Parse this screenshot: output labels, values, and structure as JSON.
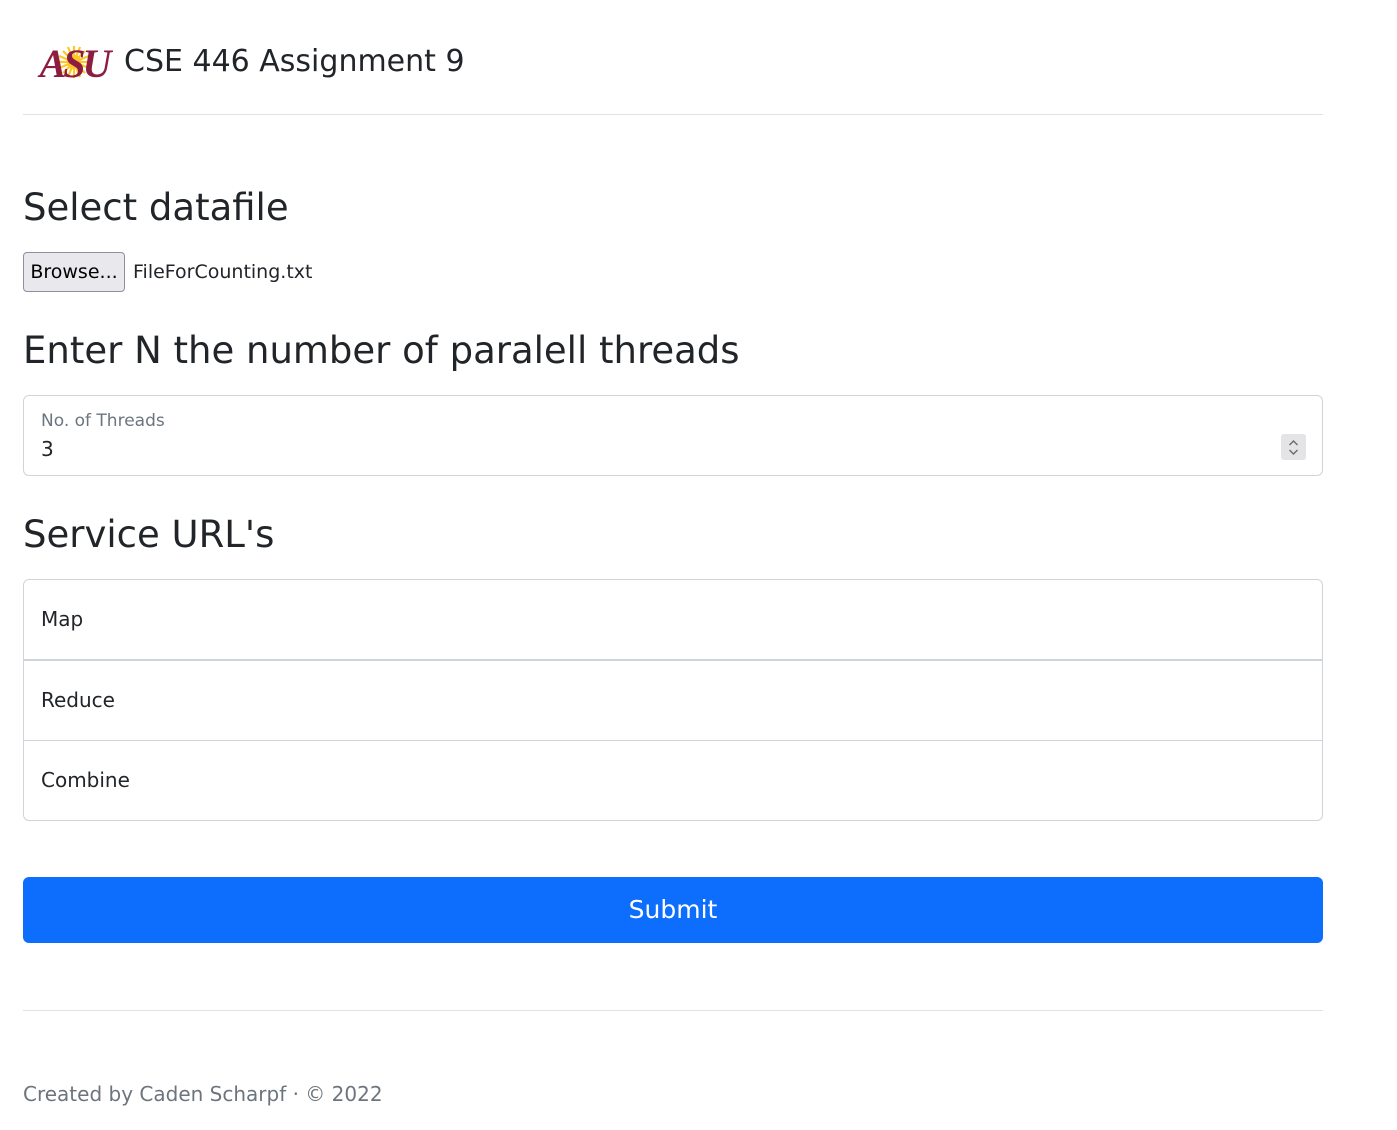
{
  "header": {
    "logo_text": "ASU",
    "title": "CSE 446 Assignment 9"
  },
  "datafile": {
    "heading": "Select datafile",
    "browse_label": "Browse...",
    "file_name": "FileForCounting.txt"
  },
  "threads": {
    "heading": "Enter N the number of paralell threads",
    "label": "No. of Threads",
    "value": "3"
  },
  "urls": {
    "heading": "Service URL's",
    "fields": [
      {
        "placeholder": "Map"
      },
      {
        "placeholder": "Reduce"
      },
      {
        "placeholder": "Combine"
      }
    ]
  },
  "submit_label": "Submit",
  "footer": {
    "text": "Created by Caden Scharpf · © 2022"
  },
  "colors": {
    "primary": "#0d6efd",
    "asu_maroon": "#8c1d40",
    "asu_gold": "#ffc627"
  }
}
